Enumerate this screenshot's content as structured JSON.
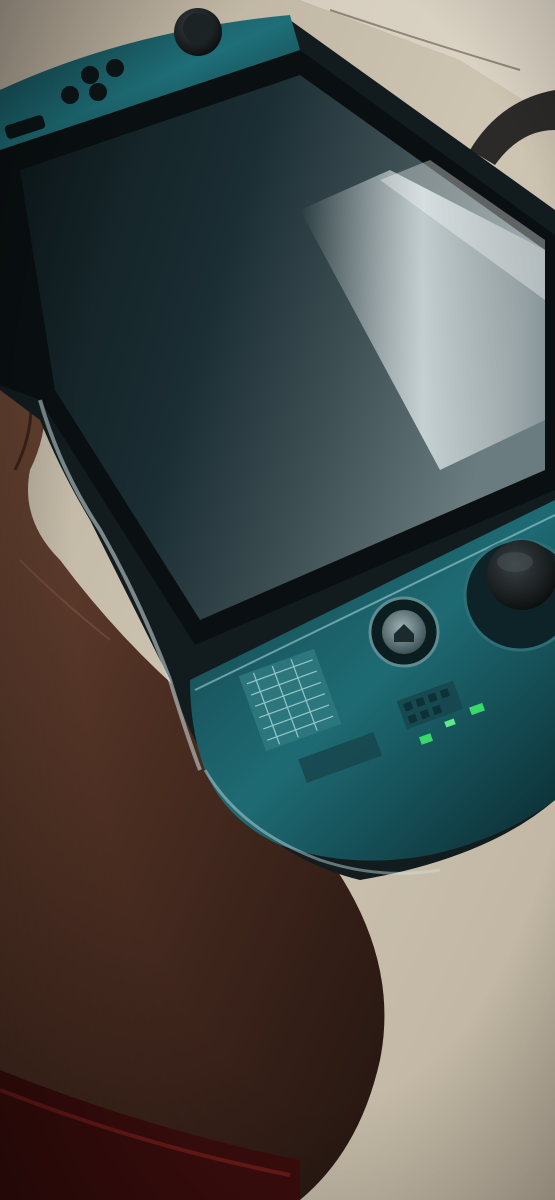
{
  "photo": {
    "subject": "handheld-game-console-in-transparent-teal-case",
    "colors": {
      "floor": "#c9bfae",
      "floor_shadow": "#7d7468",
      "skin": "#5a3a2c",
      "skin_dark": "#2b1a13",
      "sleeve": "#3a0d0c",
      "case_teal": "#1f6f78",
      "case_deep": "#0b2e35",
      "screen_glass": "#16272b",
      "screen_glare": "#d9e6e8",
      "led_green": "#39d86b"
    },
    "icons": {
      "home_button": "home-icon",
      "thumbstick": "thumbstick-icon",
      "dpad": "dpad-icon"
    }
  }
}
